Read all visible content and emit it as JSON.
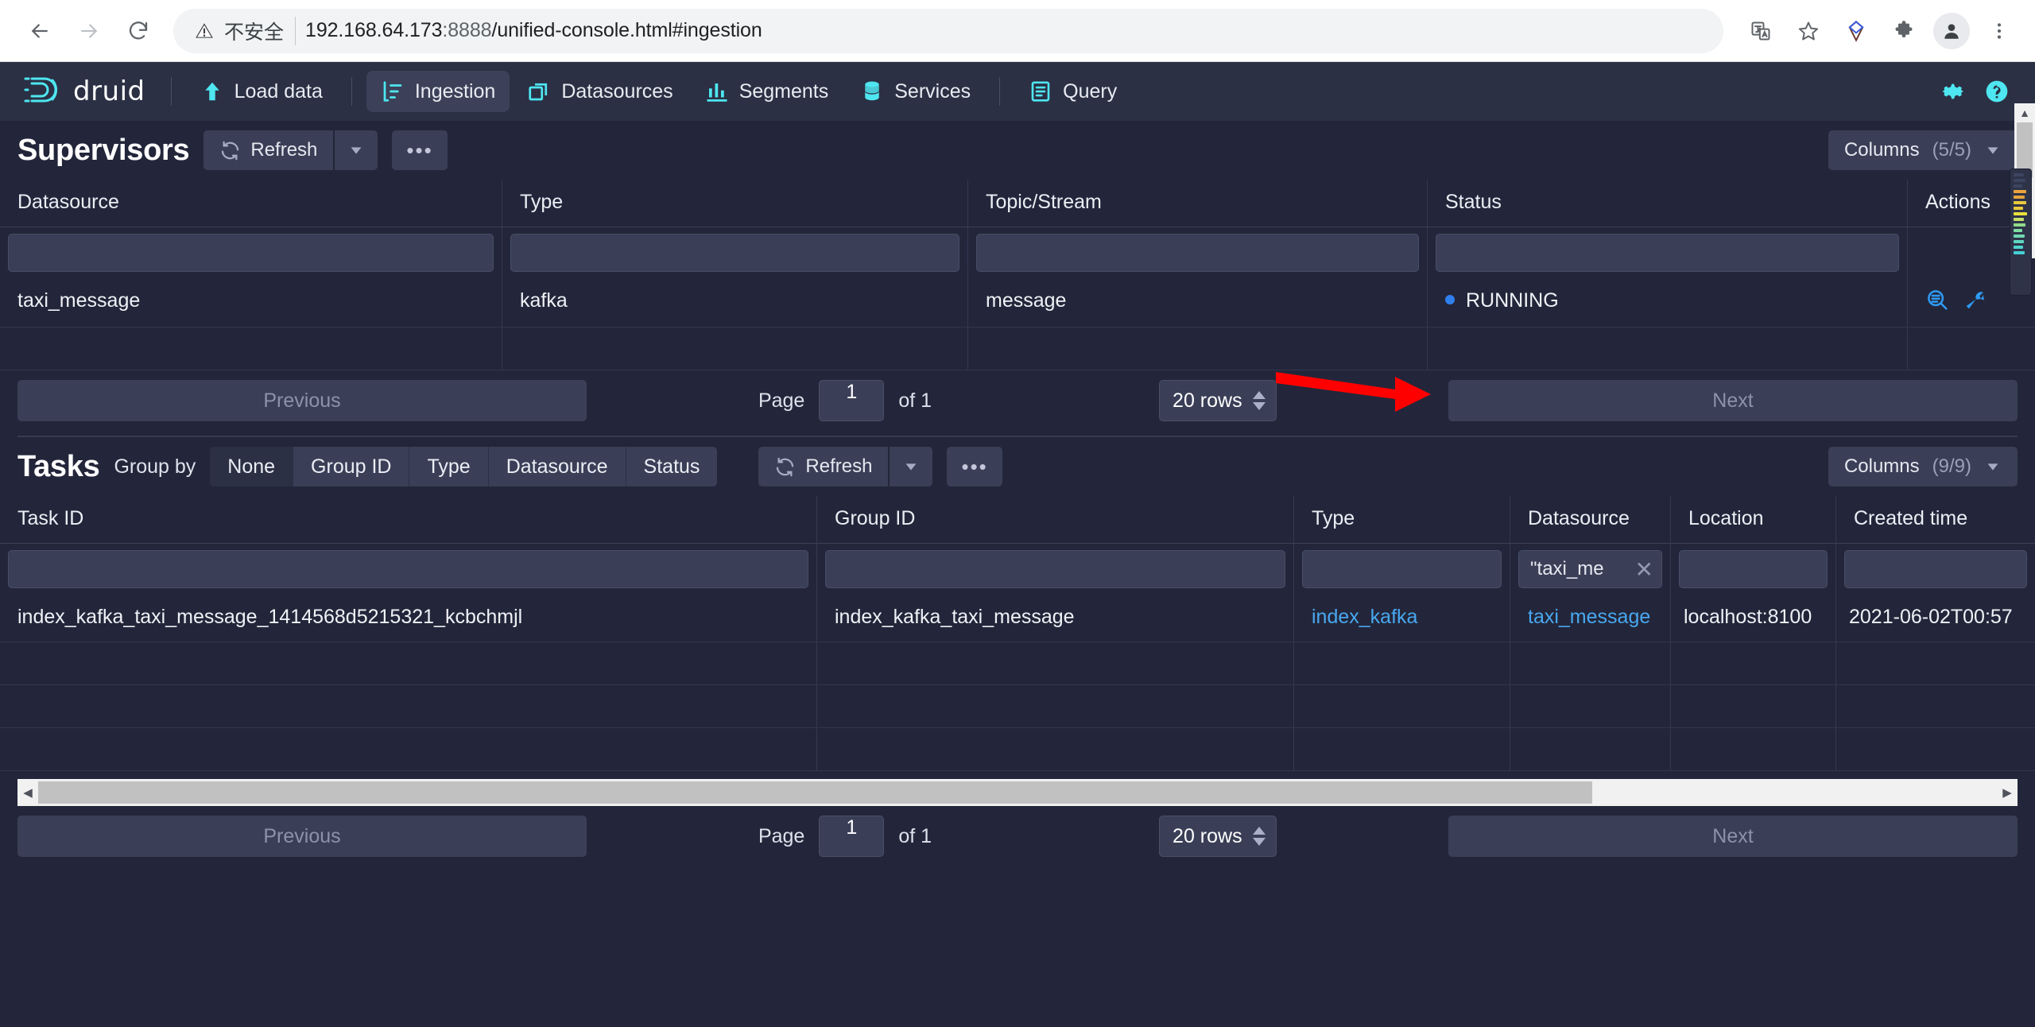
{
  "browser": {
    "back_icon": "back-arrow-icon",
    "forward_icon": "forward-arrow-icon",
    "reload_icon": "reload-icon",
    "security_label": "不安全",
    "url_host": "192.168.64.173",
    "url_port": ":8888",
    "url_path": "/unified-console.html#ingestion",
    "translate_icon": "translate-icon",
    "bookmark_icon": "star-icon",
    "extension_icon": "extension-diamond-icon",
    "puzzle_icon": "puzzle-icon",
    "profile_icon": "profile-avatar-icon",
    "menu_icon": "kebab-menu-icon"
  },
  "navbar": {
    "brand": "druid",
    "items": [
      {
        "label": "Load data",
        "icon": "upload-arrow-icon",
        "active": false
      },
      {
        "label": "Ingestion",
        "icon": "ingestion-chart-icon",
        "active": true
      },
      {
        "label": "Datasources",
        "icon": "datasources-stack-icon",
        "active": false
      },
      {
        "label": "Segments",
        "icon": "segments-bars-icon",
        "active": false
      },
      {
        "label": "Services",
        "icon": "services-database-icon",
        "active": false
      },
      {
        "label": "Query",
        "icon": "query-document-icon",
        "active": false
      }
    ],
    "right_icons": [
      {
        "name": "gear-icon"
      },
      {
        "name": "help-circle-icon"
      }
    ]
  },
  "supervisors": {
    "title": "Supervisors",
    "refresh_label": "Refresh",
    "refresh_icon": "refresh-icon",
    "dropdown_icon": "chevron-down-icon",
    "more_label": "•••",
    "columns_label": "Columns",
    "columns_count": "(5/5)",
    "headers": [
      "Datasource",
      "Type",
      "Topic/Stream",
      "Status",
      "Actions"
    ],
    "filters": [
      "",
      "",
      "",
      "",
      ""
    ],
    "rows": [
      {
        "datasource": "taxi_message",
        "type": "kafka",
        "topic": "message",
        "status": "RUNNING",
        "status_color": "#2f80ed",
        "actions": [
          "query-magnifier-icon",
          "wrench-icon"
        ]
      }
    ],
    "pagination": {
      "previous": "Previous",
      "page_label": "Page",
      "page_value": "1",
      "of_label": "of 1",
      "rows_value": "20 rows",
      "next": "Next"
    }
  },
  "tasks": {
    "title": "Tasks",
    "groupby_label": "Group by",
    "groupby_options": [
      {
        "label": "None",
        "active": true
      },
      {
        "label": "Group ID",
        "active": false
      },
      {
        "label": "Type",
        "active": false
      },
      {
        "label": "Datasource",
        "active": false
      },
      {
        "label": "Status",
        "active": false
      }
    ],
    "refresh_label": "Refresh",
    "refresh_icon": "refresh-icon",
    "dropdown_icon": "chevron-down-icon",
    "more_label": "•••",
    "columns_label": "Columns",
    "columns_count": "(9/9)",
    "headers": [
      "Task ID",
      "Group ID",
      "Type",
      "Datasource",
      "Location",
      "Created time"
    ],
    "filters": [
      "",
      "",
      "",
      "\"taxi_me",
      "",
      ""
    ],
    "filter_clear_icon": "close-x-icon",
    "rows": [
      {
        "task_id": "index_kafka_taxi_message_1414568d5215321_kcbchmjl",
        "group_id": "index_kafka_taxi_message",
        "type": "index_kafka",
        "datasource": "taxi_message",
        "location": "localhost:8100",
        "created_time": "2021-06-02T00:57"
      }
    ],
    "pagination": {
      "previous": "Previous",
      "page_label": "Page",
      "page_value": "1",
      "of_label": "of 1",
      "rows_value": "20 rows",
      "next": "Next"
    }
  },
  "annotation": {
    "arrow_color": "#ff0000",
    "arrow_target": "RUNNING status dot"
  }
}
